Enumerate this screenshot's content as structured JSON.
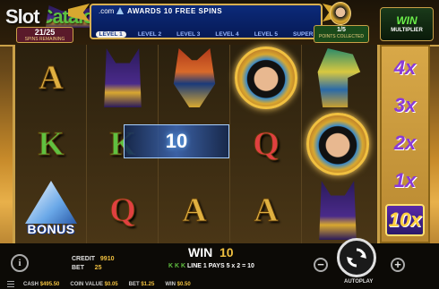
{
  "logo": {
    "text_a": "Slot",
    "text_b": "Catalog"
  },
  "spins": {
    "count": "21/25",
    "label": "SPINS REMAINING"
  },
  "banner": {
    "prefix": ".com",
    "message": "AWARDS 10 FREE SPINS",
    "levels": [
      "LEVEL 1",
      "LEVEL 2",
      "LEVEL 3",
      "LEVEL 4",
      "LEVEL 5",
      "SUPER"
    ],
    "active_level": 0
  },
  "points": {
    "count": "1/5",
    "label": "POINTS COLLECTED"
  },
  "win_multiplier": {
    "word": "WIN",
    "label": "MULTIPLIER"
  },
  "reels": [
    [
      "A",
      "K",
      "bonus"
    ],
    [
      "cat",
      "K",
      "Q"
    ],
    [
      "anubis",
      "",
      "A"
    ],
    [
      "cleopatra",
      "Q",
      "A"
    ],
    [
      "falcon",
      "cleopatra",
      "cat"
    ]
  ],
  "win_overlay": {
    "value": "10"
  },
  "multipliers": [
    "4x",
    "3x",
    "2x",
    "1x",
    "10x"
  ],
  "active_multiplier_index": 4,
  "bonus_label": "BONUS",
  "panel": {
    "credit_label": "CREDIT",
    "credit_value": "9910",
    "bet_label": "BET",
    "bet_value": "25",
    "win_label": "WIN",
    "win_value": "10",
    "line_symbols": "K K K",
    "line_text": "LINE 1 PAYS 5 x 2 = 10",
    "autoplay": "AUTOPLAY",
    "cash_label": "CASH",
    "cash_value": "$495.50",
    "coin_label": "COIN VALUE",
    "coin_value": "$0.05",
    "bet_usd_label": "BET",
    "bet_usd_value": "$1.25",
    "win_usd_label": "WIN",
    "win_usd_value": "$0.50"
  }
}
